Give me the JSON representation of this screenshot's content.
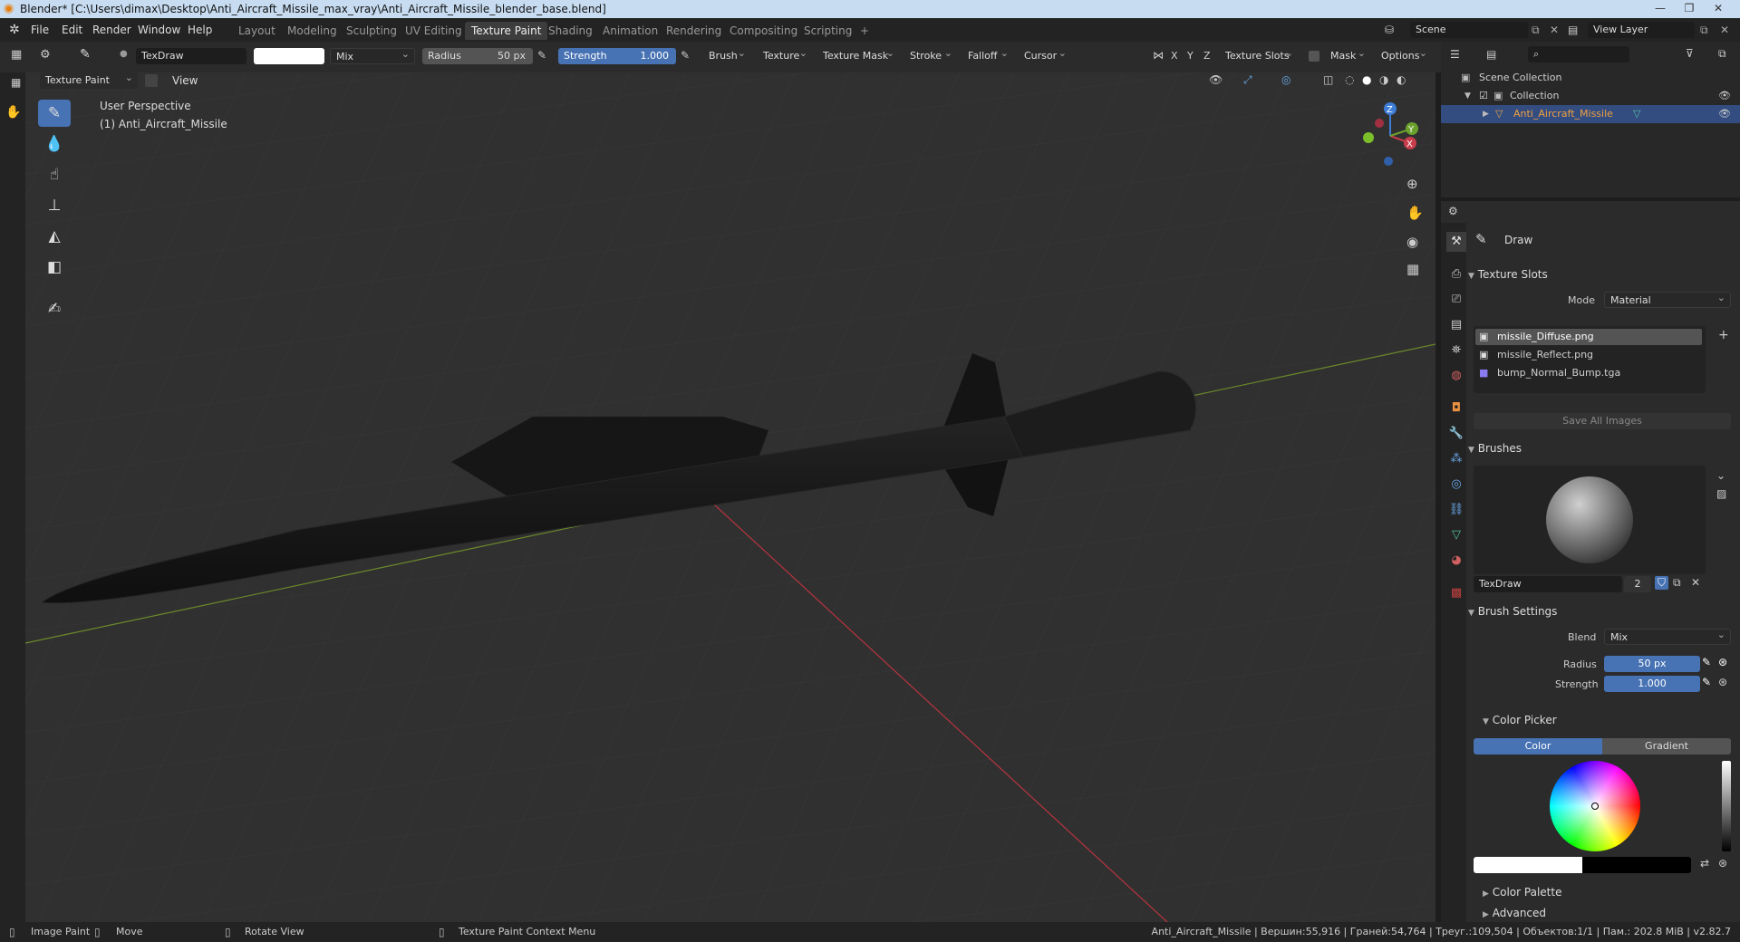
{
  "window": {
    "title": "Blender* [C:\\Users\\dimax\\Desktop\\Anti_Aircraft_Missile_max_vray\\Anti_Aircraft_Missile_blender_base.blend]",
    "minimize": "—",
    "maximize": "❐",
    "close": "✕"
  },
  "menu": [
    "File",
    "Edit",
    "Render",
    "Window",
    "Help"
  ],
  "workspaces": [
    "Layout",
    "Modeling",
    "Sculpting",
    "UV Editing",
    "Texture Paint",
    "Shading",
    "Animation",
    "Rendering",
    "Compositing",
    "Scripting",
    "+"
  ],
  "active_workspace": "Texture Paint",
  "scene": {
    "label": "Scene",
    "view_layer": "View Layer"
  },
  "toolheader": {
    "brush_name": "TexDraw",
    "blend": "Mix",
    "radius_label": "Radius",
    "radius_value": "50 px",
    "strength_label": "Strength",
    "strength_value": "1.000",
    "menus": [
      "Brush",
      "Texture",
      "Texture Mask",
      "Stroke",
      "Falloff",
      "Cursor"
    ],
    "axes": [
      "X",
      "Y",
      "Z"
    ],
    "right_menus": [
      "Texture Slots",
      "Mask",
      "Options"
    ]
  },
  "modeheader": {
    "mode": "Texture Paint",
    "view": "View"
  },
  "viewport": {
    "perspective": "User Perspective",
    "object": "(1) Anti_Aircraft_Missile",
    "gizmo": {
      "x": "X",
      "y": "Y",
      "z": "Z"
    }
  },
  "outliner": {
    "scene_collection": "Scene Collection",
    "collection": "Collection",
    "object": "Anti_Aircraft_Missile"
  },
  "properties": {
    "tool": "Draw",
    "texture_slots": {
      "title": "Texture Slots",
      "mode_label": "Mode",
      "mode_value": "Material",
      "slots": [
        "missile_Diffuse.png",
        "missile_Reflect.png",
        "bump_Normal_Bump.tga"
      ],
      "save_all": "Save All Images"
    },
    "brushes": {
      "title": "Brushes",
      "name": "TexDraw",
      "users": "2"
    },
    "brush_settings": {
      "title": "Brush Settings",
      "blend_label": "Blend",
      "blend_value": "Mix",
      "radius_label": "Radius",
      "radius_value": "50 px",
      "strength_label": "Strength",
      "strength_value": "1.000"
    },
    "color_picker": {
      "title": "Color Picker",
      "tab_color": "Color",
      "tab_gradient": "Gradient"
    },
    "color_palette": "Color Palette",
    "advanced": "Advanced"
  },
  "statusbar": {
    "image_paint": "Image Paint",
    "move": "Move",
    "rotate_view": "Rotate View",
    "context_menu": "Texture Paint Context Menu",
    "stats": "Anti_Aircraft_Missile | Вершин:55,916 | Граней:54,764 | Треуг.:109,504 | Объектов:1/1 | Пам.: 202.8 MiB | v2.82.7"
  },
  "colors": {
    "accent": "#4772b3",
    "selected": "#334d80",
    "axis_x": "#c83c4b",
    "axis_y": "#6aa12d",
    "axis_z": "#3d7dd6"
  }
}
